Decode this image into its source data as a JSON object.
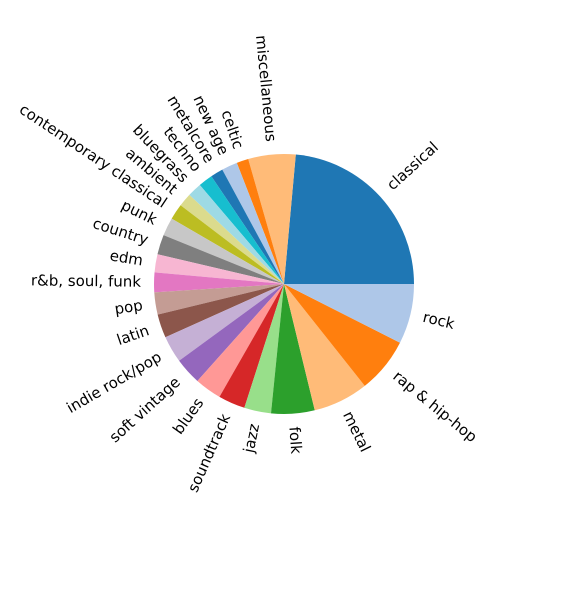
{
  "chart_data": {
    "type": "pie",
    "title": "",
    "categories": [
      "classical",
      "miscellaneous",
      "celtic",
      "new age",
      "metalcore",
      "techno",
      "bluegrass",
      "ambient",
      "contemporary classical",
      "punk",
      "country",
      "edm",
      "r&b, soul, funk",
      "pop",
      "latin",
      "indie rock/pop",
      "soft vintage",
      "blues",
      "soundtrack",
      "jazz",
      "folk",
      "metal",
      "rap & hip-hop",
      "rock"
    ],
    "values": [
      24.0,
      6.0,
      1.5,
      2.0,
      1.6,
      1.8,
      1.8,
      1.7,
      2.0,
      2.3,
      2.5,
      2.3,
      2.5,
      2.8,
      3.0,
      3.4,
      3.4,
      3.4,
      3.4,
      3.4,
      5.5,
      7.0,
      7.0,
      7.6
    ],
    "colors": [
      "#1f77b4",
      "#ffbb78",
      "#ff7f0e",
      "#aec7e8",
      "#1f77b4",
      "#17becf",
      "#9edae5",
      "#bcbd22",
      "#dbdb8d",
      "#bcbd22",
      "#c7c7c7",
      "#7f7f7f",
      "#f7b6d2",
      "#e377c2",
      "#c49c94",
      "#8c564b",
      "#c5b0d5",
      "#9467bd",
      "#ff9896",
      "#d62728",
      "#98df8a",
      "#2ca02c",
      "#ffbb78",
      "#ff7f0e"
    ],
    "slice_colors_in_label_order": [
      "#1f77b4",
      "#ffbb78",
      "#ff7f0e",
      "#aec7e8",
      "#1f77b4",
      "#17becf",
      "#9edae5",
      "#dbdb8d",
      "#bcbd22",
      "#c7c7c7",
      "#7f7f7f",
      "#f7b6d2",
      "#e377c2",
      "#c49c94",
      "#8c564b",
      "#c5b0d5",
      "#9467bd",
      "#ff9896",
      "#d62728",
      "#98df8a",
      "#2ca02c",
      "#ffbb78",
      "#ff7f0e",
      "#aec7e8"
    ],
    "start_angle_deg": 0,
    "direction": "counterclockwise",
    "legend": "none"
  }
}
